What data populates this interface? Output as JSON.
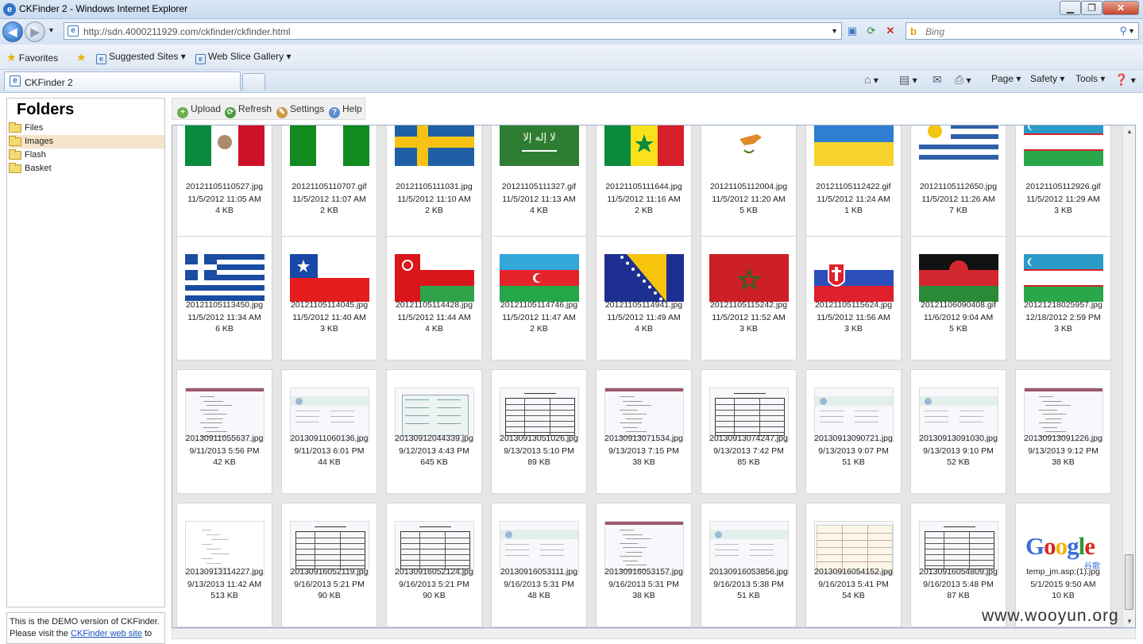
{
  "window": {
    "title": "CKFinder 2 - Windows Internet Explorer"
  },
  "address": {
    "url": "http://sdn.4000211929.com/ckfinder/ckfinder.html",
    "search_placeholder": "Bing"
  },
  "favorites_bar": {
    "favorites": "Favorites",
    "suggested": "Suggested Sites",
    "webslice": "Web Slice Gallery"
  },
  "tab": {
    "label": "CKFinder 2"
  },
  "commands": {
    "page": "Page",
    "safety": "Safety",
    "tools": "Tools"
  },
  "sidebar": {
    "title": "Folders",
    "items": [
      {
        "label": "Files"
      },
      {
        "label": "Images"
      },
      {
        "label": "Flash"
      },
      {
        "label": "Basket"
      }
    ],
    "selected": "Images",
    "note_prefix": "This is the DEMO version of CKFinder.",
    "note_text": "Please visit the",
    "note_link": "CKFinder web site",
    "note_suffix": "to"
  },
  "toolbar": {
    "upload": "Upload",
    "refresh": "Refresh",
    "settings": "Settings",
    "help": "Help"
  },
  "files": [
    [
      {
        "name": "20121105110527.jpg",
        "date": "11/5/2012 11:05 AM",
        "size": "4 KB",
        "thumb": "mexico"
      },
      {
        "name": "20121105110707.gif",
        "date": "11/5/2012 11:07 AM",
        "size": "2 KB",
        "thumb": "nigeria"
      },
      {
        "name": "20121105111031.jpg",
        "date": "11/5/2012 11:10 AM",
        "size": "2 KB",
        "thumb": "sweden"
      },
      {
        "name": "20121105111327.gif",
        "date": "11/5/2012 11:13 AM",
        "size": "4 KB",
        "thumb": "saudi"
      },
      {
        "name": "20121105111644.jpg",
        "date": "11/5/2012 11:16 AM",
        "size": "2 KB",
        "thumb": "senegal"
      },
      {
        "name": "20121105112004.jpg",
        "date": "11/5/2012 11:20 AM",
        "size": "5 KB",
        "thumb": "cyprus"
      },
      {
        "name": "20121105112422.gif",
        "date": "11/5/2012 11:24 AM",
        "size": "1 KB",
        "thumb": "ukraine"
      },
      {
        "name": "20121105112650.jpg",
        "date": "11/5/2012 11:26 AM",
        "size": "7 KB",
        "thumb": "uruguay"
      },
      {
        "name": "20121105112926.gif",
        "date": "11/5/2012 11:29 AM",
        "size": "3 KB",
        "thumb": "uzbekistan"
      }
    ],
    [
      {
        "name": "20121105113450.jpg",
        "date": "11/5/2012 11:34 AM",
        "size": "6 KB",
        "thumb": "greece"
      },
      {
        "name": "20121105114045.jpg",
        "date": "11/5/2012 11:40 AM",
        "size": "3 KB",
        "thumb": "chile"
      },
      {
        "name": "20121105114428.jpg",
        "date": "11/5/2012 11:44 AM",
        "size": "4 KB",
        "thumb": "oman"
      },
      {
        "name": "20121105114746.jpg",
        "date": "11/5/2012 11:47 AM",
        "size": "2 KB",
        "thumb": "azerbaijan"
      },
      {
        "name": "20121105114941.jpg",
        "date": "11/5/2012 11:49 AM",
        "size": "4 KB",
        "thumb": "bosnia"
      },
      {
        "name": "20121105115242.jpg",
        "date": "11/5/2012 11:52 AM",
        "size": "3 KB",
        "thumb": "morocco"
      },
      {
        "name": "20121105115624.jpg",
        "date": "11/5/2012 11:56 AM",
        "size": "3 KB",
        "thumb": "slovakia"
      },
      {
        "name": "20121106090408.gif",
        "date": "11/6/2012 9:04 AM",
        "size": "5 KB",
        "thumb": "malawi"
      },
      {
        "name": "20121218025957.jpg",
        "date": "12/18/2012 2:59 PM",
        "size": "3 KB",
        "thumb": "uzbekistan"
      }
    ],
    [
      {
        "name": "20130911055637.jpg",
        "date": "9/11/2013 5:56 PM",
        "size": "42 KB",
        "thumb": "doc-a"
      },
      {
        "name": "20130911060136.jpg",
        "date": "9/11/2013 6:01 PM",
        "size": "44 KB",
        "thumb": "doc-b"
      },
      {
        "name": "20130912044339.jpg",
        "date": "9/12/2013 4:43 PM",
        "size": "645 KB",
        "thumb": "doc-c"
      },
      {
        "name": "20130913051026.jpg",
        "date": "9/13/2013 5:10 PM",
        "size": "89 KB",
        "thumb": "doc-d"
      },
      {
        "name": "20130913071534.jpg",
        "date": "9/13/2013 7:15 PM",
        "size": "38 KB",
        "thumb": "doc-a"
      },
      {
        "name": "20130913074247.jpg",
        "date": "9/13/2013 7:42 PM",
        "size": "85 KB",
        "thumb": "doc-d"
      },
      {
        "name": "20130913090721.jpg",
        "date": "9/13/2013 9:07 PM",
        "size": "51 KB",
        "thumb": "doc-b"
      },
      {
        "name": "20130913091030.jpg",
        "date": "9/13/2013 9:10 PM",
        "size": "52 KB",
        "thumb": "doc-b"
      },
      {
        "name": "20130913091226.jpg",
        "date": "9/13/2013 9:12 PM",
        "size": "38 KB",
        "thumb": "doc-a"
      }
    ],
    [
      {
        "name": "20130913114227.jpg",
        "date": "9/13/2013 11:42 AM",
        "size": "513 KB",
        "thumb": "doc-e"
      },
      {
        "name": "20130916052119.jpg",
        "date": "9/16/2013 5:21 PM",
        "size": "90 KB",
        "thumb": "doc-d"
      },
      {
        "name": "20130916052124.jpg",
        "date": "9/16/2013 5:21 PM",
        "size": "90 KB",
        "thumb": "doc-d"
      },
      {
        "name": "20130916053111.jpg",
        "date": "9/16/2013 5:31 PM",
        "size": "48 KB",
        "thumb": "doc-b"
      },
      {
        "name": "20130916053157.jpg",
        "date": "9/16/2013 5:31 PM",
        "size": "38 KB",
        "thumb": "doc-a"
      },
      {
        "name": "20130916053856.jpg",
        "date": "9/16/2013 5:38 PM",
        "size": "51 KB",
        "thumb": "doc-b"
      },
      {
        "name": "20130916054152.jpg",
        "date": "9/16/2013 5:41 PM",
        "size": "54 KB",
        "thumb": "doc-f"
      },
      {
        "name": "20130916054809.jpg",
        "date": "9/16/2013 5:48 PM",
        "size": "87 KB",
        "thumb": "doc-d"
      },
      {
        "name": "temp_jm.asp;(1).jpg",
        "date": "5/1/2015 9:50 AM",
        "size": "10 KB",
        "thumb": "google"
      }
    ]
  ],
  "google_logo": "Google",
  "google_sub": "谷歌",
  "watermark": "www.wooyun.org",
  "colors": {
    "accent": "#3e77c0",
    "selected_folder": "#f6e5ca",
    "panel_bg": "#e6e6e6"
  }
}
